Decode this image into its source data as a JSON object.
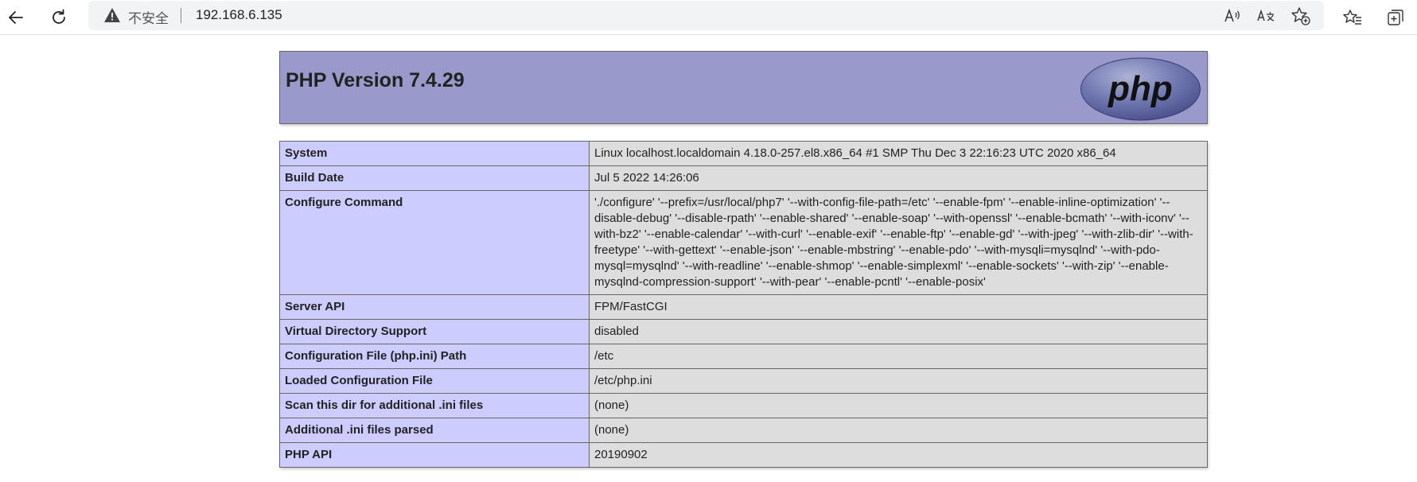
{
  "browser": {
    "security_label": "不安全",
    "separator": "|",
    "url": "192.168.6.135"
  },
  "page": {
    "title": "PHP Version 7.4.29",
    "logo_text": "php",
    "rows": [
      {
        "label": "System",
        "value": "Linux localhost.localdomain 4.18.0-257.el8.x86_64 #1 SMP Thu Dec 3 22:16:23 UTC 2020 x86_64"
      },
      {
        "label": "Build Date",
        "value": "Jul 5 2022 14:26:06"
      },
      {
        "label": "Configure Command",
        "value": "'./configure' '--prefix=/usr/local/php7' '--with-config-file-path=/etc' '--enable-fpm' '--enable-inline-optimization' '--disable-debug' '--disable-rpath' '--enable-shared' '--enable-soap' '--with-openssl' '--enable-bcmath' '--with-iconv' '--with-bz2' '--enable-calendar' '--with-curl' '--enable-exif' '--enable-ftp' '--enable-gd' '--with-jpeg' '--with-zlib-dir' '--with-freetype' '--with-gettext' '--enable-json' '--enable-mbstring' '--enable-pdo' '--with-mysqli=mysqlnd' '--with-pdo-mysql=mysqlnd' '--with-readline' '--enable-shmop' '--enable-simplexml' '--enable-sockets' '--with-zip' '--enable-mysqlnd-compression-support' '--with-pear' '--enable-pcntl' '--enable-posix'"
      },
      {
        "label": "Server API",
        "value": "FPM/FastCGI"
      },
      {
        "label": "Virtual Directory Support",
        "value": "disabled"
      },
      {
        "label": "Configuration File (php.ini) Path",
        "value": "/etc"
      },
      {
        "label": "Loaded Configuration File",
        "value": "/etc/php.ini"
      },
      {
        "label": "Scan this dir for additional .ini files",
        "value": "(none)"
      },
      {
        "label": "Additional .ini files parsed",
        "value": "(none)"
      },
      {
        "label": "PHP API",
        "value": "20190902"
      }
    ]
  },
  "icons": {
    "back": "arrow-left-icon",
    "refresh": "refresh-icon",
    "warning": "warning-triangle-icon",
    "read_aloud": "read-aloud-icon",
    "translate": "translate-icon",
    "add_favorite": "star-plus-icon",
    "favorites": "favorites-list-icon",
    "collections": "collections-icon"
  },
  "colors": {
    "header_bg": "#9999cc",
    "label_bg": "#ccccff",
    "value_bg": "#dddddd"
  }
}
